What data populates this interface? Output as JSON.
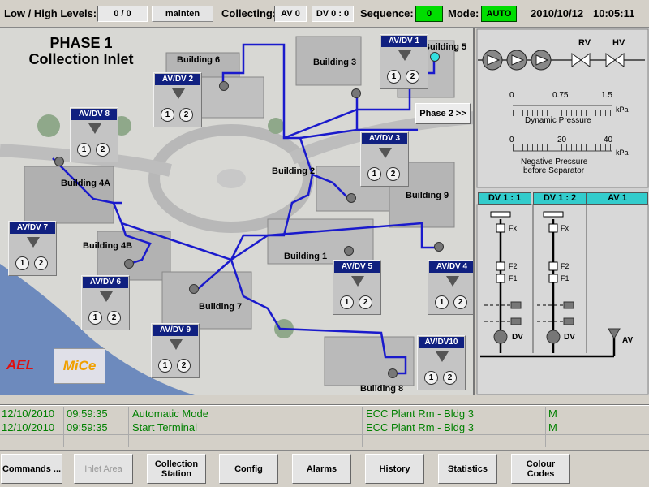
{
  "topbar": {
    "levels_label": "Low / High Levels:",
    "levels_value": "0 / 0",
    "mode_button": "mainten",
    "collecting_label": "Collecting:",
    "av_value": "AV 0",
    "dv_value": "DV 0 : 0",
    "sequence_label": "Sequence:",
    "sequence_value": "0",
    "mode_label": "Mode:",
    "mode_value": "AUTO",
    "date": "2010/10/12",
    "time": "10:05:11"
  },
  "map": {
    "title_line1": "PHASE 1",
    "title_line2": "Collection Inlet",
    "phase2_button": "Phase 2 >>",
    "buildings": [
      "Building 6",
      "Building 3",
      "Building 5",
      "Building 4A",
      "Building 2",
      "Building 9",
      "Building 4B",
      "Building 1",
      "Building 7",
      "Building 8"
    ],
    "panels": [
      {
        "title": "AV/DV 1"
      },
      {
        "title": "AV/DV 2"
      },
      {
        "title": "AV/DV 8"
      },
      {
        "title": "AV/DV 3"
      },
      {
        "title": "AV/DV 7"
      },
      {
        "title": "AV/DV 6"
      },
      {
        "title": "AV/DV 5"
      },
      {
        "title": "AV/DV 4"
      },
      {
        "title": "AV/DV 9"
      },
      {
        "title": "AV/DV10"
      }
    ],
    "circle_1": "1",
    "circle_2": "2",
    "logos": {
      "ael": "AEL",
      "mice": "MiCe"
    }
  },
  "gauges": {
    "rv": "RV",
    "hv": "HV",
    "dyn_ticks": [
      "0",
      "0.75",
      "1.5"
    ],
    "dyn_unit": "kPa",
    "dyn_label": "Dynamic Pressure",
    "neg_ticks": [
      "0",
      "20",
      "40"
    ],
    "neg_unit": "kPa",
    "neg_label_1": "Negative Pressure",
    "neg_label_2": "before Separator"
  },
  "schematic": {
    "head1": "DV 1 : 1",
    "head2": "DV 1 : 2",
    "head3": "AV 1",
    "fx": "Fx",
    "f2": "F2",
    "f1": "F1",
    "dv": "DV",
    "av": "AV"
  },
  "log": [
    {
      "date": "12/10/2010",
      "time": "09:59:35",
      "event": "Automatic Mode",
      "location": "ECC Plant Rm - Bldg 3",
      "type": "M"
    },
    {
      "date": "12/10/2010",
      "time": "09:59:35",
      "event": "Start Terminal",
      "location": "ECC Plant Rm - Bldg 3",
      "type": "M"
    }
  ],
  "buttons": {
    "commands": "Commands ...",
    "inlet": "Inlet Area",
    "collection": "Collection Station",
    "config": "Config",
    "alarms": "Alarms",
    "history": "History",
    "statistics": "Statistics",
    "colour": "Colour Codes"
  },
  "colors": {
    "pipe": "#1a1acc",
    "status_green": "#00dd00",
    "header_cyan": "#33cccc",
    "panel_title": "#102080",
    "log_text": "#008000"
  }
}
